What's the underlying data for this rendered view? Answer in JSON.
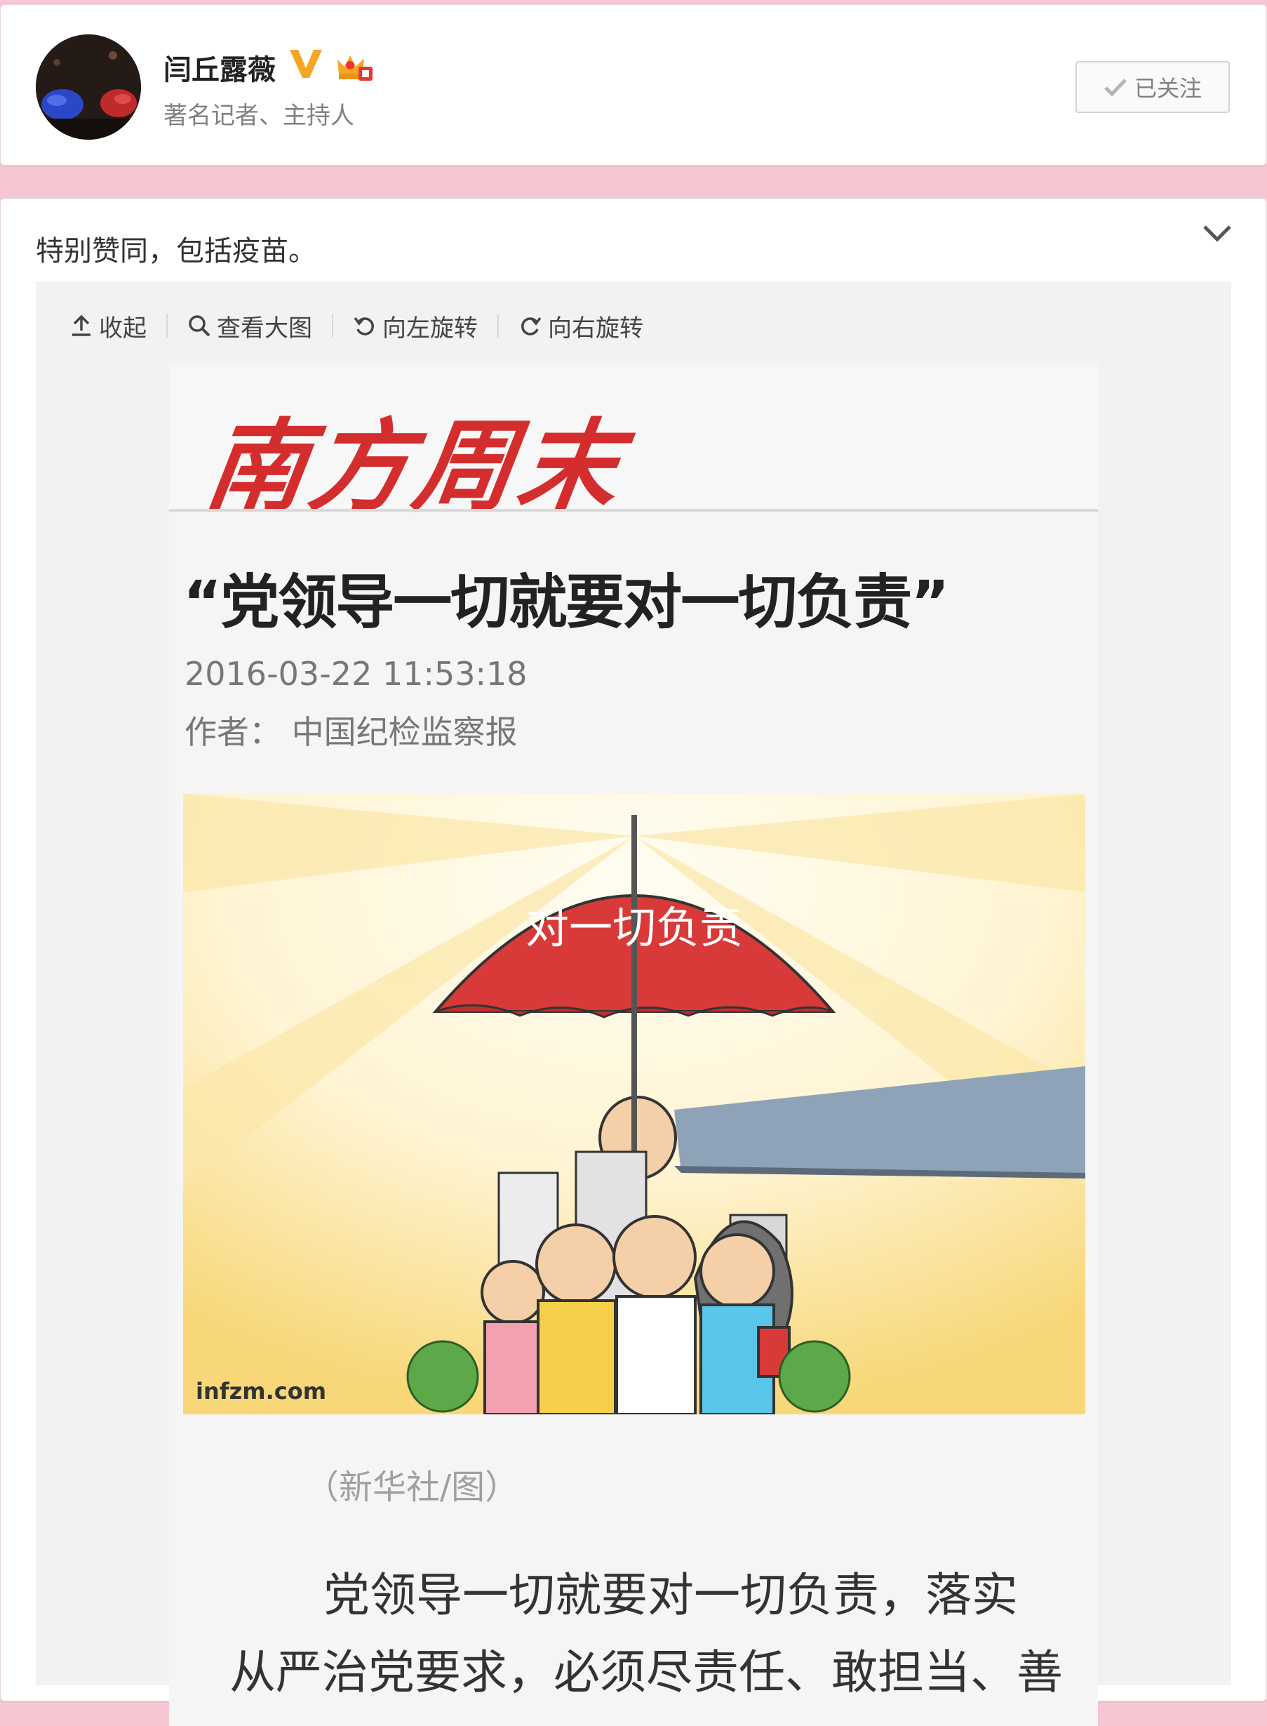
{
  "profile": {
    "name": "闫丘露薇",
    "bio": "著名记者、主持人",
    "follow_label": "已关注",
    "icons": [
      "verified-v-icon",
      "vip-crown-icon",
      "check-icon"
    ],
    "badge_color": "#f5a623"
  },
  "post": {
    "text": "特别赞同，包括疫苗。",
    "toolbar": {
      "collapse": "收起",
      "view_large": "查看大图",
      "rotate_left": "向左旋转",
      "rotate_right": "向右旋转"
    },
    "article": {
      "masthead": "南方周末",
      "headline": "“党领导一切就要对一切负责”",
      "date": "2016-03-22 11:53:18",
      "author": "作者：  中国纪检监察报",
      "illustration_caption": "对一切负责",
      "watermark": "infzm.com",
      "photo_credit": "（新华社/图）",
      "body_lines": [
        "党领导一切就要对一切负责，落实",
        "从严治党要求，必须尽责任、敢担当、善"
      ]
    }
  },
  "colors": {
    "page_background": "#f7c6d3",
    "masthead_red": "#d42d2d",
    "umbrella_red": "#d83a3a"
  }
}
